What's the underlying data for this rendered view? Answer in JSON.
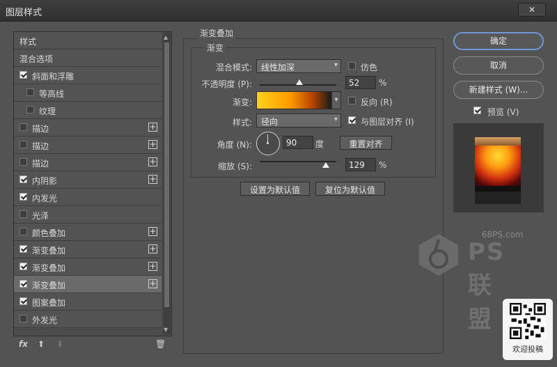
{
  "window": {
    "title": "图层样式",
    "close": "✕"
  },
  "left_panel": {
    "header_style": "样式",
    "header_blend": "混合选项",
    "items": [
      {
        "label": "斜面和浮雕",
        "checked": true,
        "indent": 0,
        "plus": false
      },
      {
        "label": "等高线",
        "checked": false,
        "indent": 1,
        "plus": false
      },
      {
        "label": "纹理",
        "checked": false,
        "indent": 1,
        "plus": false
      },
      {
        "label": "描边",
        "checked": false,
        "indent": 0,
        "plus": true
      },
      {
        "label": "描边",
        "checked": false,
        "indent": 0,
        "plus": true
      },
      {
        "label": "描边",
        "checked": false,
        "indent": 0,
        "plus": true
      },
      {
        "label": "内阴影",
        "checked": true,
        "indent": 0,
        "plus": true
      },
      {
        "label": "内发光",
        "checked": true,
        "indent": 0,
        "plus": false
      },
      {
        "label": "光泽",
        "checked": false,
        "indent": 0,
        "plus": false
      },
      {
        "label": "颜色叠加",
        "checked": false,
        "indent": 0,
        "plus": true
      },
      {
        "label": "渐变叠加",
        "checked": true,
        "indent": 0,
        "plus": true
      },
      {
        "label": "渐变叠加",
        "checked": true,
        "indent": 0,
        "plus": true
      },
      {
        "label": "渐变叠加",
        "checked": true,
        "indent": 0,
        "plus": true,
        "selected": true
      },
      {
        "label": "图案叠加",
        "checked": true,
        "indent": 0,
        "plus": false
      },
      {
        "label": "外发光",
        "checked": false,
        "indent": 0,
        "plus": false
      }
    ],
    "footer": {
      "fx": "fx",
      "up": "⬆",
      "down": "⬇",
      "trash": "🗑"
    }
  },
  "gradient_overlay": {
    "group_title": "渐变叠加",
    "sub_title": "渐变",
    "blend_mode_label": "混合模式:",
    "blend_mode_value": "线性加深",
    "dither_label": "仿色",
    "dither_checked": false,
    "opacity_label": "不透明度 (P):",
    "opacity_value": "52",
    "opacity_fraction": 0.52,
    "opacity_unit": "%",
    "gradient_label": "渐变:",
    "reverse_label": "反向 (R)",
    "reverse_checked": false,
    "style_label": "样式:",
    "style_value": "径向",
    "align_label": "与图层对齐 (I)",
    "align_checked": true,
    "angle_label": "角度 (N):",
    "angle_value": "90",
    "angle_unit": "度",
    "reset_align_label": "重置对齐",
    "scale_label": "缩放 (S):",
    "scale_value": "129",
    "scale_fraction": 0.86,
    "scale_unit": "%",
    "set_default_label": "设置为默认值",
    "reset_default_label": "复位为默认值"
  },
  "right_panel": {
    "ok_label": "确定",
    "cancel_label": "取消",
    "new_style_label": "新建样式 (W)...",
    "preview_label": "预览 (V)",
    "preview_checked": true
  },
  "watermark": {
    "site": "68PS.com",
    "logo": "PS联盟"
  },
  "qr": {
    "caption": "欢迎投稿"
  },
  "colors": {
    "accent": "#6e97d8",
    "panel_bg": "#535353",
    "selected_row": "#6a6a6a"
  }
}
